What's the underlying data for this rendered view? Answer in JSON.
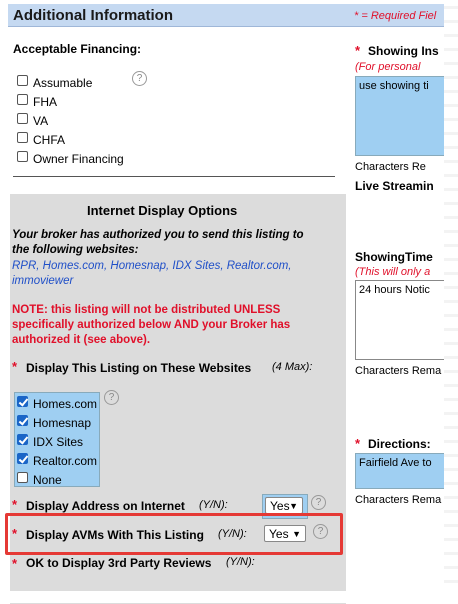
{
  "header": {
    "title": "Additional Information",
    "required_note": "* = Required Fiel"
  },
  "financing": {
    "label": "Acceptable Financing:",
    "options": [
      {
        "label": "Assumable",
        "checked": false
      },
      {
        "label": "FHA",
        "checked": false
      },
      {
        "label": "VA",
        "checked": false
      },
      {
        "label": "CHFA",
        "checked": false
      },
      {
        "label": "Owner Financing",
        "checked": false
      }
    ]
  },
  "internet": {
    "title": "Internet Display Options",
    "auth_text_1": "Your broker has authorized you to send this listing to",
    "auth_text_2": "the following websites:",
    "sites_line_1": "RPR, Homes.com, Homesnap, IDX Sites, Realtor.com,",
    "sites_line_2": "immoviewer",
    "note_1": "NOTE: this listing will not be distributed UNLESS",
    "note_2": "specifically authorized below AND your Broker has",
    "note_3": "authorized it (see above).",
    "display_websites_label": "Display This Listing on These Websites",
    "display_websites_max": "(4 Max):",
    "websites": [
      {
        "label": "Homes.com",
        "checked": true
      },
      {
        "label": "Homesnap",
        "checked": true
      },
      {
        "label": "IDX Sites",
        "checked": true
      },
      {
        "label": "Realtor.com",
        "checked": true
      },
      {
        "label": "None",
        "checked": false
      }
    ],
    "display_address_label": "Display Address on Internet",
    "display_address_yn": "(Y/N):",
    "display_address_value": "Yes",
    "display_avms_label": "Display AVMs With This Listing",
    "display_avms_yn": "(Y/N):",
    "display_avms_value": "Yes",
    "third_party_label": "OK to Display 3rd Party Reviews",
    "third_party_yn": "(Y/N):"
  },
  "right": {
    "showing_label": "Showing Ins",
    "showing_sub": "(For personal",
    "showing_value": "use showing ti",
    "chars_remaining_1": "Characters Re",
    "live_streaming": "Live Streamin",
    "showingtime_label": "ShowingTime",
    "showingtime_sub": "(This will only a",
    "showingtime_value": "24 hours Notic",
    "chars_remaining_2": "Characters Rema",
    "directions_label": "Directions:",
    "directions_value": "Fairfield Ave to",
    "chars_remaining_3": "Characters Rema"
  },
  "icons": {
    "help": "help-circle-icon",
    "check": "checkmark-icon",
    "chevron": "chevron-down-icon"
  },
  "colors": {
    "header_bg": "#c5d9f1",
    "required_red": "#e0102a",
    "link_blue": "#1f4fc8",
    "panel_gray": "#dcdcdc",
    "field_blue": "#9fcff2",
    "highlight_red": "#e53935"
  }
}
